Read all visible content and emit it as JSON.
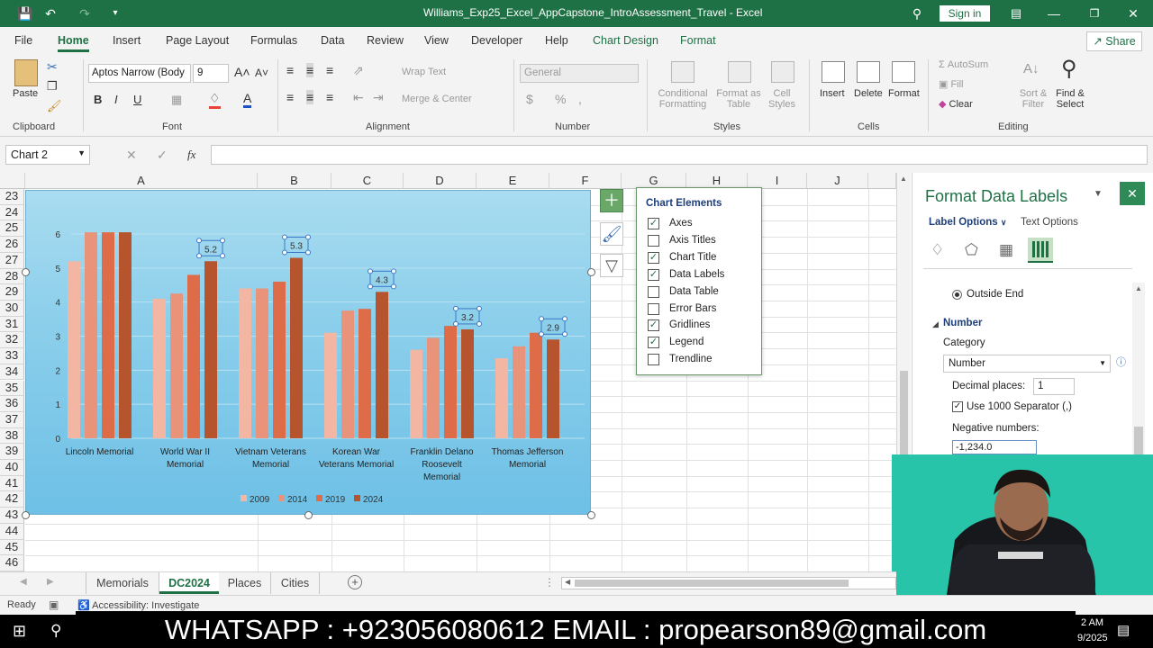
{
  "window": {
    "title": "Williams_Exp25_Excel_AppCapstone_IntroAssessment_Travel - Excel",
    "signin": "Sign in"
  },
  "menu": {
    "tabs": [
      "File",
      "Home",
      "Insert",
      "Page Layout",
      "Formulas",
      "Data",
      "Review",
      "View",
      "Developer",
      "Help",
      "Chart Design",
      "Format"
    ],
    "share": "Share"
  },
  "ribbon": {
    "clipboard": {
      "paste": "Paste",
      "label": "Clipboard"
    },
    "font": {
      "name": "Aptos Narrow (Body",
      "size": "9",
      "label": "Font"
    },
    "alignment": {
      "wrap": "Wrap Text",
      "merge": "Merge & Center",
      "label": "Alignment"
    },
    "number": {
      "format": "General",
      "label": "Number"
    },
    "styles": {
      "conditional": "Conditional Formatting",
      "format_table": "Format as Table",
      "cell_styles": "Cell Styles",
      "label": "Styles"
    },
    "cells": {
      "insert": "Insert",
      "delete": "Delete",
      "format": "Format",
      "label": "Cells"
    },
    "editing": {
      "autosum": "AutoSum",
      "fill": "Fill",
      "clear": "Clear",
      "sort": "Sort & Filter",
      "find": "Find & Select",
      "label": "Editing"
    }
  },
  "formula": {
    "namebox": "Chart 2",
    "fx": "fx",
    "value": ""
  },
  "columns": [
    "A",
    "B",
    "C",
    "D",
    "E",
    "F",
    "G",
    "H",
    "I",
    "J"
  ],
  "rows": [
    "23",
    "24",
    "25",
    "26",
    "27",
    "28",
    "29",
    "30",
    "31",
    "32",
    "33",
    "34",
    "35",
    "36",
    "37",
    "38",
    "39",
    "40",
    "41",
    "42",
    "43",
    "44",
    "45",
    "46"
  ],
  "chart_data": {
    "type": "bar",
    "categories": [
      "Lincoln Memorial",
      "World War II Memorial",
      "Vietnam Veterans Memorial",
      "Korean War Veterans Memorial",
      "Franklin Delano Roosevelt Memorial",
      "Thomas Jefferson Memorial"
    ],
    "category_lines": [
      [
        "Lincoln Memorial"
      ],
      [
        "World War II",
        "Memorial"
      ],
      [
        "Vietnam Veterans",
        "Memorial"
      ],
      [
        "Korean War",
        "Veterans Memorial"
      ],
      [
        "Franklin Delano",
        "Roosevelt",
        "Memorial"
      ],
      [
        "Thomas Jefferson",
        "Memorial"
      ]
    ],
    "series": [
      {
        "name": "2009",
        "color": "#f3b6a3",
        "values": [
          5.2,
          4.1,
          4.4,
          3.1,
          2.6,
          2.35
        ]
      },
      {
        "name": "2014",
        "color": "#e9937a",
        "values": [
          6.5,
          4.25,
          4.4,
          3.75,
          2.95,
          2.7
        ]
      },
      {
        "name": "2019",
        "color": "#de6c48",
        "values": [
          6.5,
          4.8,
          4.6,
          3.8,
          3.3,
          3.1
        ]
      },
      {
        "name": "2024",
        "color": "#b6542d",
        "values": [
          6.5,
          5.2,
          5.3,
          4.3,
          3.2,
          2.9
        ]
      }
    ],
    "data_labels": [
      "",
      "5.2",
      "5.3",
      "4.3",
      "3.2",
      "2.9"
    ],
    "yticks": [
      "0",
      "1",
      "2",
      "3",
      "4",
      "5",
      "6"
    ],
    "ylim": [
      0,
      6
    ],
    "legend_position": "bottom",
    "gridlines": true
  },
  "chart_elements": {
    "title": "Chart Elements",
    "items": [
      {
        "label": "Axes",
        "checked": true
      },
      {
        "label": "Axis Titles",
        "checked": false
      },
      {
        "label": "Chart Title",
        "checked": true
      },
      {
        "label": "Data Labels",
        "checked": true
      },
      {
        "label": "Data Table",
        "checked": false
      },
      {
        "label": "Error Bars",
        "checked": false
      },
      {
        "label": "Gridlines",
        "checked": true
      },
      {
        "label": "Legend",
        "checked": true
      },
      {
        "label": "Trendline",
        "checked": false
      }
    ]
  },
  "pane": {
    "title": "Format Data Labels",
    "label_options": "Label Options",
    "text_options": "Text Options",
    "outside_end": "Outside End",
    "number_section": "Number",
    "category_label": "Category",
    "category_value": "Number",
    "decimal_label": "Decimal places:",
    "decimal_value": "1",
    "separator": "Use 1000 Separator (,)",
    "negative_label": "Negative numbers:",
    "negative_value": "-1,234.0"
  },
  "sheet_tabs": [
    "Memorials",
    "DC2024",
    "Places",
    "Cities"
  ],
  "active_tab": "DC2024",
  "status": {
    "ready": "Ready",
    "accessibility": "Accessibility: Investigate"
  },
  "banner": "WHATSAPP : +923056080612 EMAIL : propearson89@gmail.com",
  "clock": {
    "time": "2 AM",
    "date": "9/2025"
  }
}
